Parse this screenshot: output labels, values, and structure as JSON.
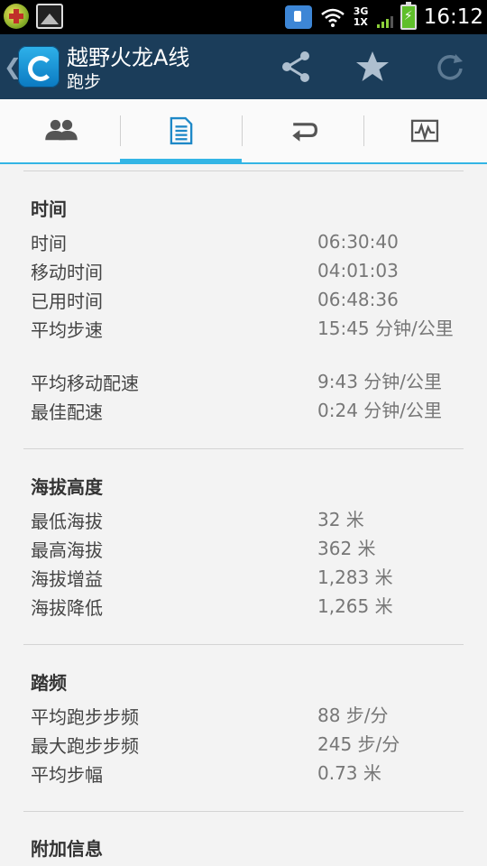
{
  "status_bar": {
    "time": "16:12",
    "network_top": "3G",
    "network_bottom": "1X",
    "icons": [
      "app-notification-icon",
      "image-notification-icon",
      "media-icon",
      "wifi-icon",
      "signal-icon",
      "battery-charging-icon"
    ]
  },
  "action_bar": {
    "title": "越野火龙A线",
    "subtitle": "跑步",
    "icons": [
      "up-caret-icon",
      "app-icon",
      "share-icon",
      "star-icon",
      "refresh-icon"
    ]
  },
  "tabs": {
    "active_index": 1,
    "items": [
      {
        "icon": "people-icon"
      },
      {
        "icon": "document-icon"
      },
      {
        "icon": "repeat-icon"
      },
      {
        "icon": "chart-icon"
      }
    ]
  },
  "sections": [
    {
      "title": "时间",
      "rows": [
        {
          "label": "时间",
          "value": "06:30:40"
        },
        {
          "label": "移动时间",
          "value": "04:01:03"
        },
        {
          "label": "已用时间",
          "value": "06:48:36"
        },
        {
          "label": "平均步速",
          "value": "15:45 分钟/公里"
        },
        {
          "label": "平均移动配速",
          "value": "9:43 分钟/公里"
        },
        {
          "label": "最佳配速",
          "value": "0:24 分钟/公里"
        }
      ]
    },
    {
      "title": "海拔高度",
      "rows": [
        {
          "label": "最低海拔",
          "value": "32 米"
        },
        {
          "label": "最高海拔",
          "value": "362 米"
        },
        {
          "label": "海拔增益",
          "value": "1,283 米"
        },
        {
          "label": "海拔降低",
          "value": "1,265 米"
        }
      ]
    },
    {
      "title": "踏频",
      "rows": [
        {
          "label": "平均跑步步频",
          "value": "88 步/分"
        },
        {
          "label": "最大跑步步频",
          "value": "245 步/分"
        },
        {
          "label": "平均步幅",
          "value": "0.73 米"
        }
      ]
    },
    {
      "title": "附加信息",
      "rows": []
    }
  ],
  "colors": {
    "action_bar": "#1b3d5a",
    "tab_indicator": "#33b5e5",
    "status_bar": "#000000",
    "background": "#f3f3f3"
  }
}
